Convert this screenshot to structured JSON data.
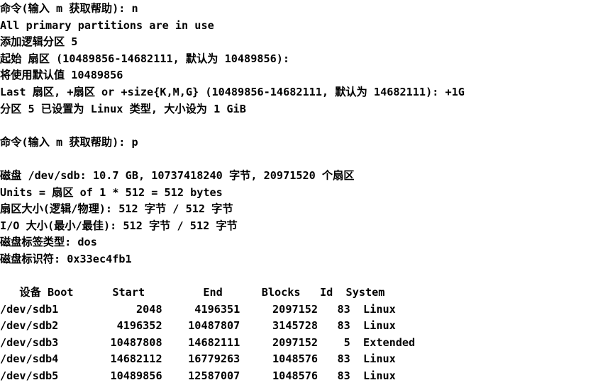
{
  "terminal": {
    "background_color": "#ffffff",
    "text_color": "#000000",
    "program": "fdisk",
    "device": "/dev/sdb"
  },
  "lines": [
    {
      "id": "prompt-new-partition",
      "text": "命令(输入 m 获取帮助): n"
    },
    {
      "id": "all-primary-in-use",
      "text": "All primary partitions are in use"
    },
    {
      "id": "adding-logical-part",
      "text": "添加逻辑分区 5"
    },
    {
      "id": "first-sector-prompt",
      "text": "起始 扇区 (10489856-14682111, 默认为 10489856): "
    },
    {
      "id": "using-default-value",
      "text": "将使用默认值 10489856"
    },
    {
      "id": "last-sector-prompt",
      "text": "Last 扇区, +扇区 or +size{K,M,G} (10489856-14682111, 默认为 14682111): +1G"
    },
    {
      "id": "partition-set-notice",
      "text": "分区 5 已设置为 Linux 类型, 大小设为 1 GiB"
    },
    {
      "id": "blank-1",
      "text": ""
    },
    {
      "id": "prompt-print-table",
      "text": "命令(输入 m 获取帮助): p"
    },
    {
      "id": "blank-2",
      "text": ""
    },
    {
      "id": "disk-summary",
      "text": "磁盘 /dev/sdb: 10.7 GB, 10737418240 字节, 20971520 个扇区"
    },
    {
      "id": "units-line",
      "text": "Units = 扇区 of 1 * 512 = 512 bytes"
    },
    {
      "id": "sector-size-line",
      "text": "扇区大小(逻辑/物理): 512 字节 / 512 字节"
    },
    {
      "id": "io-size-line",
      "text": "I/O 大小(最小/最佳): 512 字节 / 512 字节"
    },
    {
      "id": "disklabel-type-line",
      "text": "磁盘标签类型: dos"
    },
    {
      "id": "disk-identifier-line",
      "text": "磁盘标识符: 0x33ec4fb1"
    },
    {
      "id": "blank-3",
      "text": ""
    },
    {
      "id": "table-header",
      "text": "   设备 Boot      Start         End      Blocks   Id  System"
    },
    {
      "id": "row-sdb1",
      "text": "/dev/sdb1            2048     4196351     2097152   83  Linux"
    },
    {
      "id": "row-sdb2",
      "text": "/dev/sdb2         4196352    10487807     3145728   83  Linux"
    },
    {
      "id": "row-sdb3",
      "text": "/dev/sdb3        10487808    14682111     2097152    5  Extended"
    },
    {
      "id": "row-sdb4",
      "text": "/dev/sdb4        14682112    16779263     1048576   83  Linux"
    },
    {
      "id": "row-sdb5",
      "text": "/dev/sdb5        10489856    12587007     1048576   83  Linux"
    }
  ],
  "partition_table": {
    "headers": [
      "设备",
      "Boot",
      "Start",
      "End",
      "Blocks",
      "Id",
      "System"
    ],
    "rows": [
      {
        "device": "/dev/sdb1",
        "boot": "",
        "start": "2048",
        "end": "4196351",
        "blocks": "2097152",
        "id": "83",
        "system": "Linux"
      },
      {
        "device": "/dev/sdb2",
        "boot": "",
        "start": "4196352",
        "end": "10487807",
        "blocks": "3145728",
        "id": "83",
        "system": "Linux"
      },
      {
        "device": "/dev/sdb3",
        "boot": "",
        "start": "10487808",
        "end": "14682111",
        "blocks": "2097152",
        "id": "5",
        "system": "Extended"
      },
      {
        "device": "/dev/sdb4",
        "boot": "",
        "start": "14682112",
        "end": "16779263",
        "blocks": "1048576",
        "id": "83",
        "system": "Linux"
      },
      {
        "device": "/dev/sdb5",
        "boot": "",
        "start": "10489856",
        "end": "12587007",
        "blocks": "1048576",
        "id": "83",
        "system": "Linux"
      }
    ]
  },
  "disk_info": {
    "device": "/dev/sdb",
    "size_human": "10.7 GB",
    "size_bytes": "10737418240",
    "total_sectors": "20971520",
    "unit_size": "512",
    "sector_size_logical": "512",
    "sector_size_physical": "512",
    "io_size_min": "512",
    "io_size_optimal": "512",
    "disklabel_type": "dos",
    "disk_identifier": "0x33ec4fb1"
  },
  "interaction": {
    "command_new": "n",
    "command_print": "p",
    "logical_partition_number": "5",
    "first_sector_range": "10489856-14682111",
    "first_sector_default": "10489856",
    "last_sector_range": "10489856-14682111",
    "last_sector_default": "14682111",
    "last_sector_entered": "+1G",
    "partition_type": "Linux",
    "partition_size": "1 GiB"
  }
}
